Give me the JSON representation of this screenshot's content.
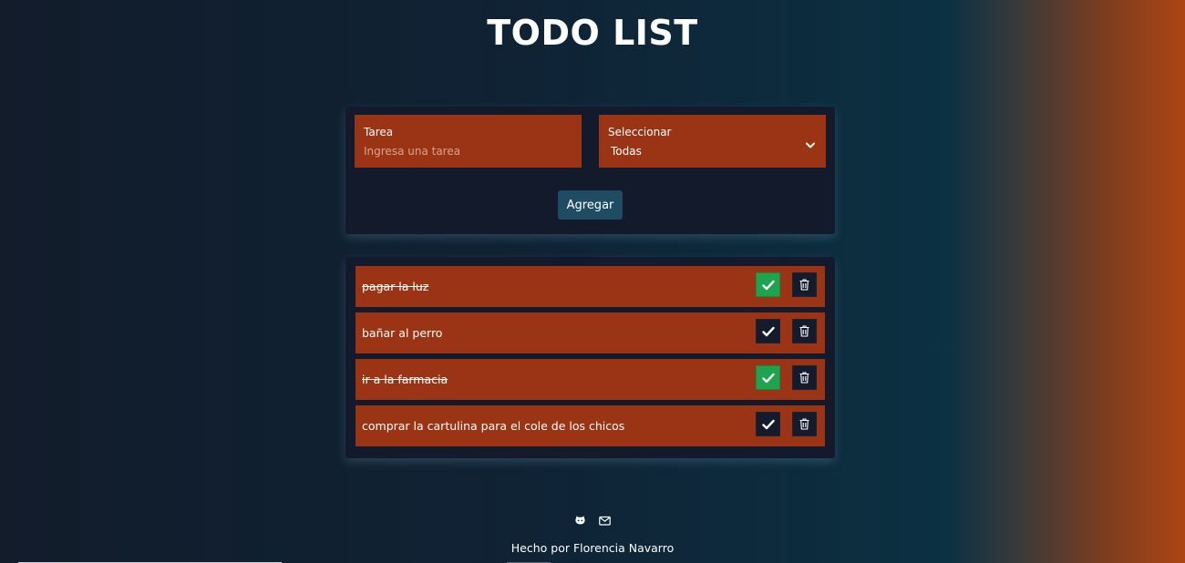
{
  "header": {
    "title": "TODO LIST"
  },
  "form": {
    "task_label": "Tarea",
    "task_placeholder": "Ingresa una tarea",
    "task_value": "",
    "select_label": "Seleccionar",
    "select_value": "Todas",
    "add_label": "Agregar"
  },
  "todos": [
    {
      "text": "pagar la luz",
      "done": true
    },
    {
      "text": "bañar al perro",
      "done": false
    },
    {
      "text": "ir a la farmacia",
      "done": true
    },
    {
      "text": "comprar la cartulina para el cole de los chicos",
      "done": false
    }
  ],
  "footer": {
    "icons": [
      "github-icon",
      "mail-icon"
    ],
    "credit": "Hecho por Florencia Navarro"
  },
  "colors": {
    "accent": "#9a3414",
    "card": "#131a2b",
    "button": "#1d4c63",
    "done": "#1ea34f"
  }
}
